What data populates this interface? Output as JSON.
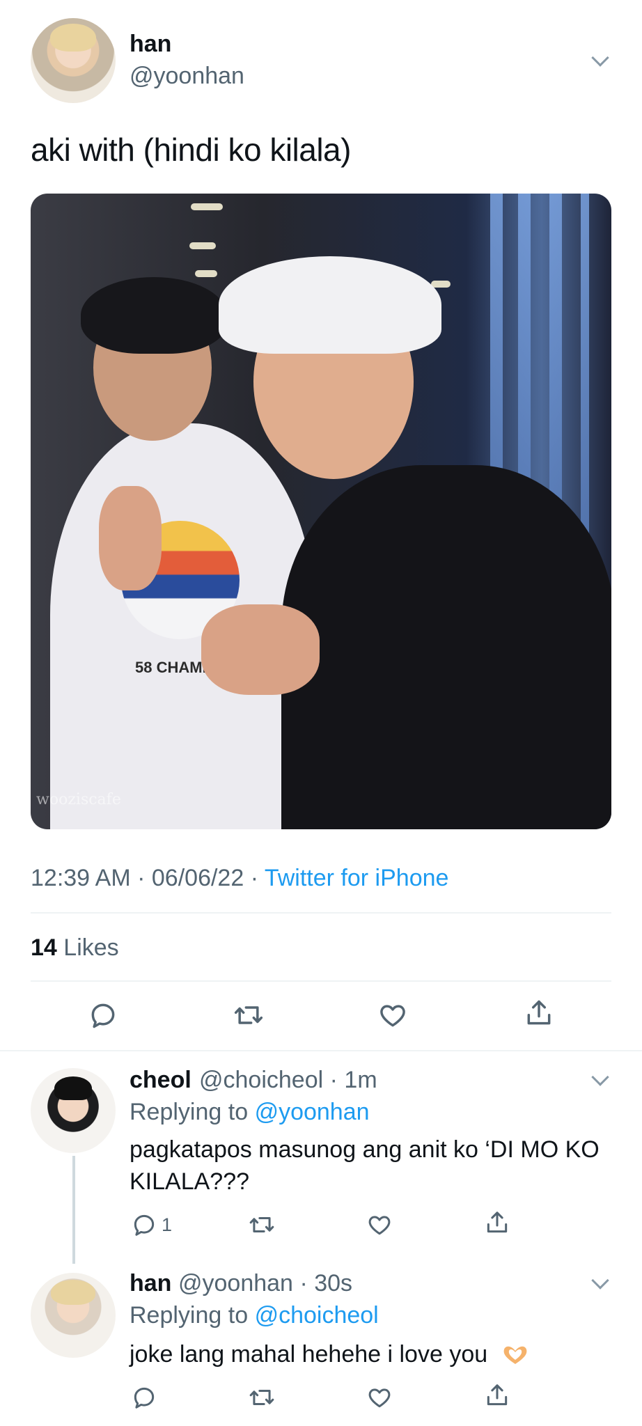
{
  "main_tweet": {
    "author_name": "han",
    "author_handle": "@yoonhan",
    "text": "aki with (hindi ko kilala)",
    "photo_watermark": "wooziscafe",
    "photo_shirt_text": "58 CHAMPS",
    "time": "12:39 AM",
    "date": "06/06/22",
    "source": "Twitter for iPhone",
    "likes_count": "14",
    "likes_label": "Likes",
    "actions": [
      "reply-icon",
      "retweet-icon",
      "like-icon",
      "share-icon"
    ]
  },
  "replies": [
    {
      "author_name": "cheol",
      "author_handle": "@choicheol",
      "age": "1m",
      "replying_prefix": "Replying to",
      "replying_to": "@yoonhan",
      "text": "pagkatapos masunog ang anit ko ‘DI MO KO KILALA???",
      "reply_count": "1"
    },
    {
      "author_name": "han",
      "author_handle": "@yoonhan",
      "age": "30s",
      "replying_prefix": "Replying to",
      "replying_to": "@choicheol",
      "text": "joke lang mahal hehehe i love you",
      "emoji": "heart-hands-emoji"
    }
  ],
  "colors": {
    "link": "#1d9bf0",
    "secondary_text": "#536471",
    "primary_text": "#0f1419",
    "divider": "#eff3f4"
  }
}
